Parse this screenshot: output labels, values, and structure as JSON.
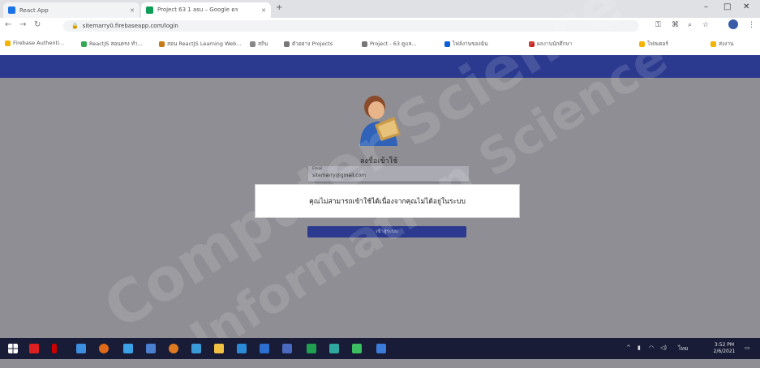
{
  "browser": {
    "tabs": [
      {
        "label": "React App"
      },
      {
        "label": "Project 63 1 asu – Google ดร"
      }
    ],
    "new_tab": "+",
    "address": "sitemarry0.firebaseapp.com/login",
    "bookmarks": [
      "Firebase Authenti...",
      "ReactJS สอนตรง ทำ...",
      "สอน ReactJS Learning Web...",
      "สถิน",
      "ตัวอย่าง Projects",
      "Project - 63 ดูแล...",
      "ไฟล์งานของฉัน",
      "ผลงานนักศึกษา",
      "โฟลเดอร์",
      "ส่งงาน"
    ],
    "window_controls": [
      "–",
      "□",
      "✕"
    ]
  },
  "page": {
    "login_title": "ลงชื่อเข้าใช้",
    "email_label": "Email",
    "email_value": "sitemarry@gmail.com",
    "submit_label": "เข้าสู่ระบบ",
    "dialog_message": "คุณไม่สามารถเข้าใช้ได้เนื่องจากคุณไม่ได้อยู่ในระบบ"
  },
  "watermark": {
    "lines": [
      "Computer Science",
      "Information Science"
    ]
  },
  "taskbar": {
    "time": "3:52 PM",
    "date": "2/6/2021",
    "lang": "ไทย"
  },
  "colors": {
    "appbar": "#2b3a8f",
    "overlay": "#8e8e94",
    "taskbar": "#181c36"
  }
}
